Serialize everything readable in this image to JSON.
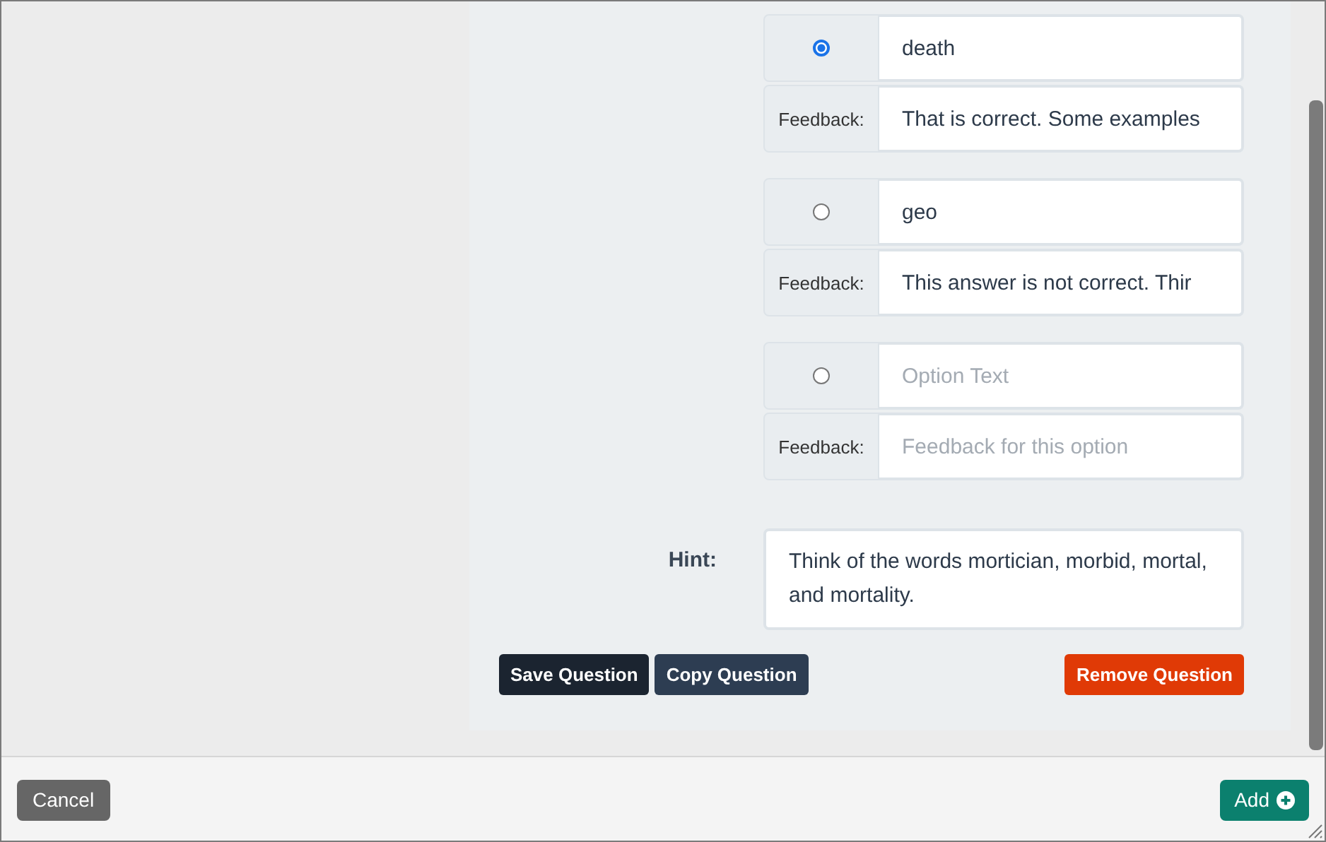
{
  "options": [
    {
      "selected": true,
      "text": "death",
      "feedback_label": "Feedback:",
      "feedback": "That is correct. Some examples"
    },
    {
      "selected": false,
      "text": "geo",
      "feedback_label": "Feedback:",
      "feedback": "This answer is not correct. Thir"
    },
    {
      "selected": false,
      "placeholder": "Option Text",
      "feedback_label": "Feedback:",
      "feedback_placeholder": "Feedback for this option"
    }
  ],
  "hint": {
    "label": "Hint:",
    "text": "Think of the words mortician, morbid, mortal, and mortality."
  },
  "question_buttons": [
    {
      "kind": "save",
      "label": "Save Question"
    },
    {
      "kind": "copy",
      "label": "Copy Question"
    },
    {
      "kind": "remove",
      "label": "Remove Question"
    }
  ],
  "footer": {
    "cancel": "Cancel",
    "add": "Add"
  }
}
